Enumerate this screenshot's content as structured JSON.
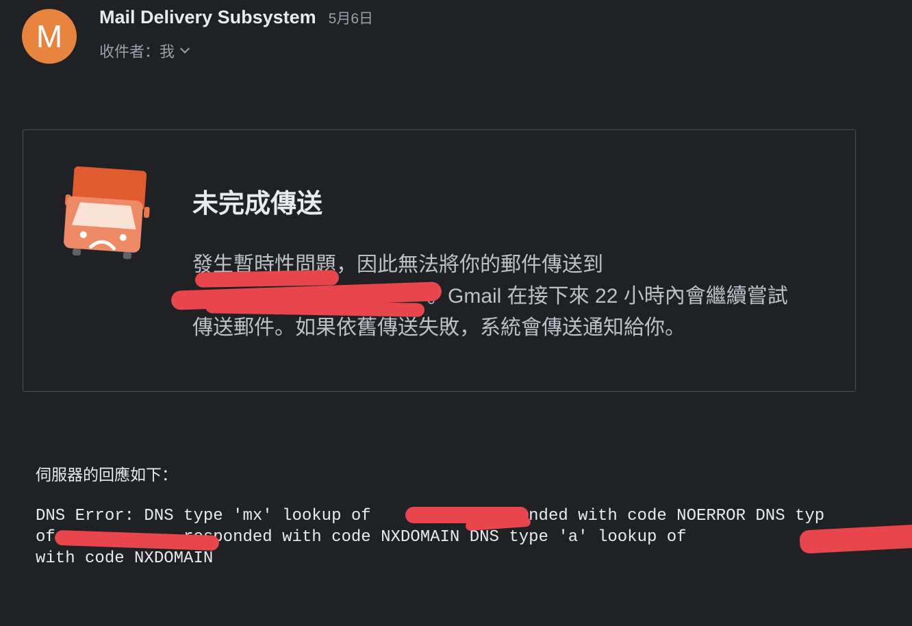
{
  "header": {
    "avatar_letter": "M",
    "sender_name": "Mail Delivery Subsystem",
    "date": "5月6日",
    "recipient_label": "收件者：我"
  },
  "card": {
    "title": "未完成傳送",
    "body_line1": "發生暫時性問題，因此無法將你的郵件傳送到",
    "body_line2_suffix": "。Gmail 在接下來 22 小時內會繼續嘗試",
    "body_line3": "傳送郵件。如果依舊傳送失敗，系統會傳送通知給你。"
  },
  "server_response": {
    "label": "伺服器的回應如下：",
    "line1_a": "DNS Error: DNS type 'mx' lookup of",
    "line1_b": " responded with code NOERROR DNS typ",
    "line2_a": "of",
    "line2_b": ". responded with code NXDOMAIN DNS type 'a' lookup of",
    "line3": "with code NXDOMAIN"
  },
  "colors": {
    "background": "#202124",
    "avatar": "#e8843e",
    "link": "#8ab4f8",
    "redaction": "#e8464c"
  }
}
